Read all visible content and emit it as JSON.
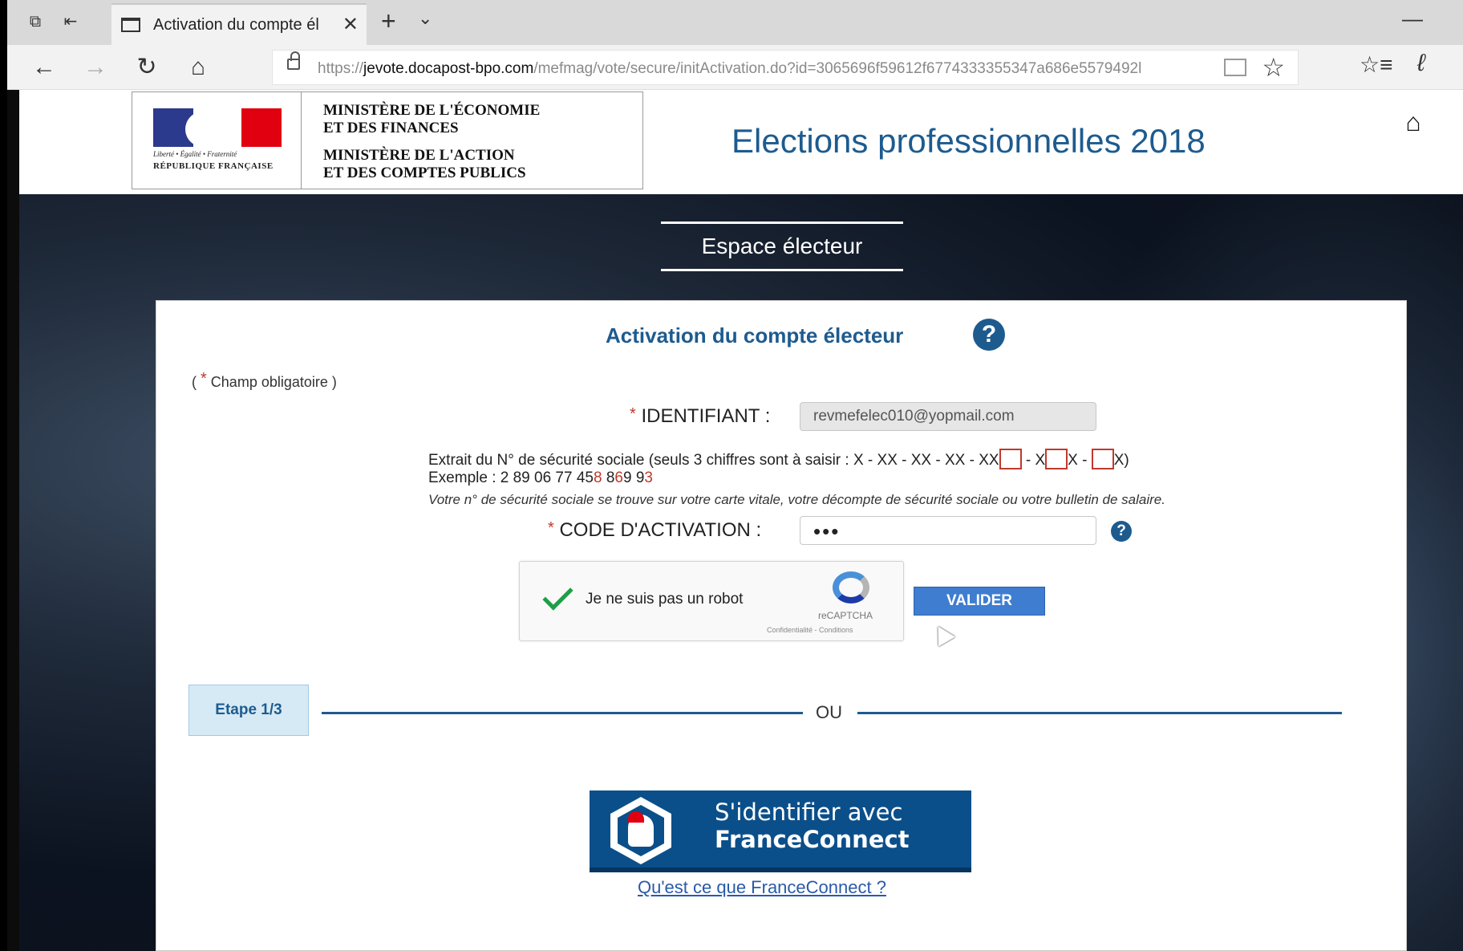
{
  "browser": {
    "tab_title": "Activation du compte él",
    "url_scheme": "https://",
    "url_host": "jevote.docapost-bpo.com",
    "url_path": "/mefmag/vote/secure/initActivation.do?id=3065696f59612f6774333355347a686e5579492l"
  },
  "header": {
    "logo_motto": "Liberté • Égalité • Fraternité",
    "logo_republique": "RÉPUBLIQUE FRANÇAISE",
    "ministry_line1": "MINISTÈRE DE L'ÉCONOMIE",
    "ministry_line2": "ET DES FINANCES",
    "ministry_line3": "MINISTÈRE DE L'ACTION",
    "ministry_line4": "ET DES COMPTES PUBLICS",
    "site_title": "Elections professionnelles 2018"
  },
  "espace_label": "Espace électeur",
  "form": {
    "title": "Activation du compte électeur",
    "help_symbol": "?",
    "mandatory_open": "( ",
    "mandatory_star": "*",
    "mandatory_text": " Champ obligatoire )",
    "required_star": "*",
    "id_label": " IDENTIFIANT :",
    "id_value": "revmefelec010@yopmail.com",
    "ss_prefix": "Extrait du N° de sécurité sociale (seuls 3 chiffres sont à saisir : X - XX - XX - XX - XX",
    "ss_sep1": " - X",
    "ss_sep2": "X - ",
    "ss_suffix": "X)",
    "example_prefix": "Exemple : 2 89 06 77 45",
    "example_d1": "8",
    "example_mid1": " 8",
    "example_d2": "6",
    "example_mid2": "9 9",
    "example_d3": "3",
    "note": "Votre n° de sécurité sociale se trouve sur votre carte vitale, votre décompte de sécurité sociale ou votre bulletin de salaire.",
    "code_label": " CODE D'ACTIVATION :",
    "code_value": "•••",
    "captcha_label": "Je ne suis pas un robot",
    "captcha_brand": "reCAPTCHA",
    "captcha_links": "Confidentialité - Conditions",
    "submit_label": "VALIDER"
  },
  "steps": {
    "current": "Etape 1/3",
    "separator": "OU"
  },
  "franceconnect": {
    "line1": "S'identifier avec",
    "line2": "FranceConnect",
    "link": "Qu'est ce que FranceConnect ?"
  },
  "colors": {
    "brand_blue": "#1d5b8f",
    "button_blue": "#3f7dd0",
    "required_red": "#c0392b",
    "franceconnect_blue": "#0b4f8a"
  }
}
